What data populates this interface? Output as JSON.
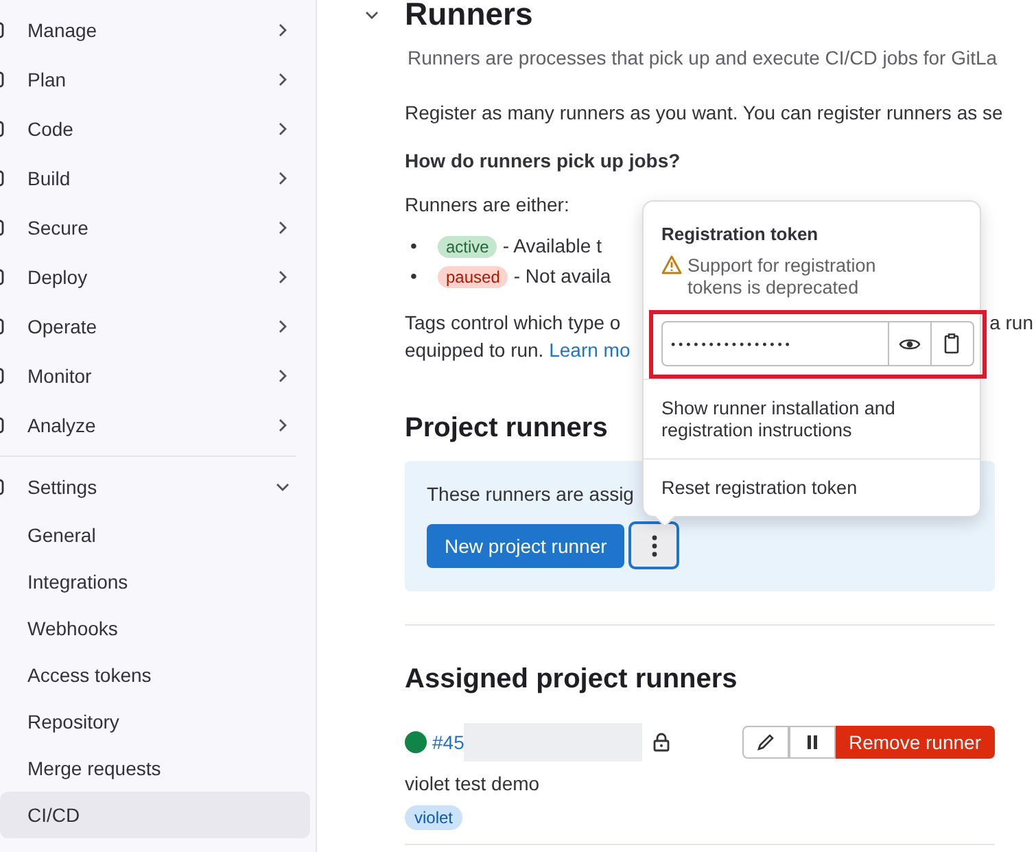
{
  "sidebar": {
    "items": [
      {
        "label": "Manage",
        "expanded": false
      },
      {
        "label": "Plan",
        "expanded": false
      },
      {
        "label": "Code",
        "expanded": false
      },
      {
        "label": "Build",
        "expanded": false
      },
      {
        "label": "Secure",
        "expanded": false
      },
      {
        "label": "Deploy",
        "expanded": false
      },
      {
        "label": "Operate",
        "expanded": false
      },
      {
        "label": "Monitor",
        "expanded": false
      },
      {
        "label": "Analyze",
        "expanded": false
      },
      {
        "label": "Settings",
        "expanded": true,
        "children": [
          {
            "label": "General",
            "selected": false
          },
          {
            "label": "Integrations",
            "selected": false
          },
          {
            "label": "Webhooks",
            "selected": false
          },
          {
            "label": "Access tokens",
            "selected": false
          },
          {
            "label": "Repository",
            "selected": false
          },
          {
            "label": "Merge requests",
            "selected": false
          },
          {
            "label": "CI/CD",
            "selected": true
          }
        ]
      }
    ]
  },
  "section": {
    "title": "Runners",
    "expanded": true,
    "description": "Runners are processes that pick up and execute CI/CD jobs for GitLa",
    "paragraph": "Register as many runners as you want. You can register runners as se",
    "question": "How do runners pick up jobs?",
    "either_label": "Runners are either:",
    "states": [
      {
        "kind": "active",
        "marker": "•",
        "badge": "active",
        "text": "- Available t"
      },
      {
        "kind": "paused",
        "marker": "•",
        "badge": "paused",
        "text": "- Not availa"
      }
    ],
    "tags_line1": "Tags control which type o",
    "tags_line1_tail": "a run",
    "tags_line2": "equipped to run.",
    "learn_more": "Learn mo"
  },
  "project_runners": {
    "title": "Project runners",
    "notice": "These runners are assig",
    "new_button": "New project runner"
  },
  "popover": {
    "title": "Registration token",
    "warning": "Support for registration tokens is deprecated",
    "token": "••••••••••••••••",
    "highlighted": true,
    "items": [
      "Show runner installation and registration instructions",
      "Reset registration token"
    ]
  },
  "assigned": {
    "title": "Assigned project runners",
    "runners": [
      {
        "color": "#108548",
        "id": "#45",
        "locked": true,
        "description": "violet test demo",
        "tags": [
          "violet"
        ],
        "remove_button": "Remove runner"
      }
    ]
  }
}
